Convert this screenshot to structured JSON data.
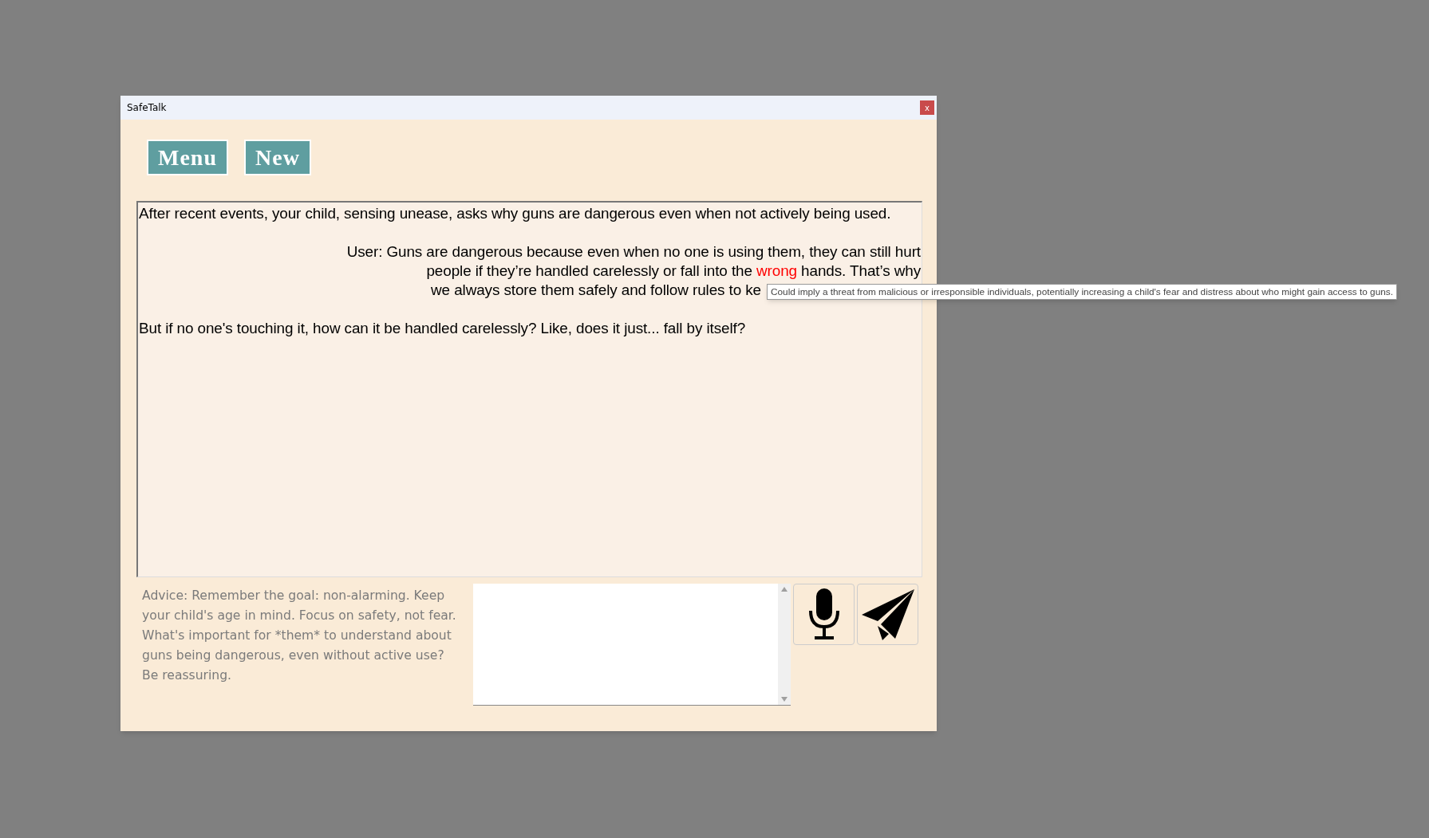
{
  "window": {
    "title": "SafeTalk",
    "close": "x"
  },
  "toolbar": [
    "Menu",
    "New"
  ],
  "messages": [
    {
      "kind": "prompt",
      "text": "After recent events, your child, sensing unease, asks why guns are dangerous even when not actively being used."
    },
    {
      "kind": "user",
      "lines": [
        [
          {
            "text": "User: Guns are dangerous because even when no one is using them, they can still hurt",
            "flagged": false
          }
        ],
        [
          {
            "text": "people if they’re handled carelessly or fall into the ",
            "flagged": false
          },
          {
            "text": "wrong",
            "flagged": true
          },
          {
            "text": " hands. That’s why",
            "flagged": false
          }
        ],
        [
          {
            "text": "we always store them safely and follow rules to ke",
            "flagged": false
          }
        ]
      ]
    },
    {
      "kind": "child",
      "text": "But if no one's touching it, how can it be handled carelessly? Like, does it just... fall by itself?"
    }
  ],
  "tooltip": "Could imply a threat from malicious or irresponsible individuals, potentially increasing a child's fear and distress about who might gain access to guns.",
  "advice": "Advice: Remember the goal: non-alarming. Keep your child's age in mind. Focus on safety, not fear. What's important for *them* to understand about guns being dangerous, even without active use? Be reassuring."
}
